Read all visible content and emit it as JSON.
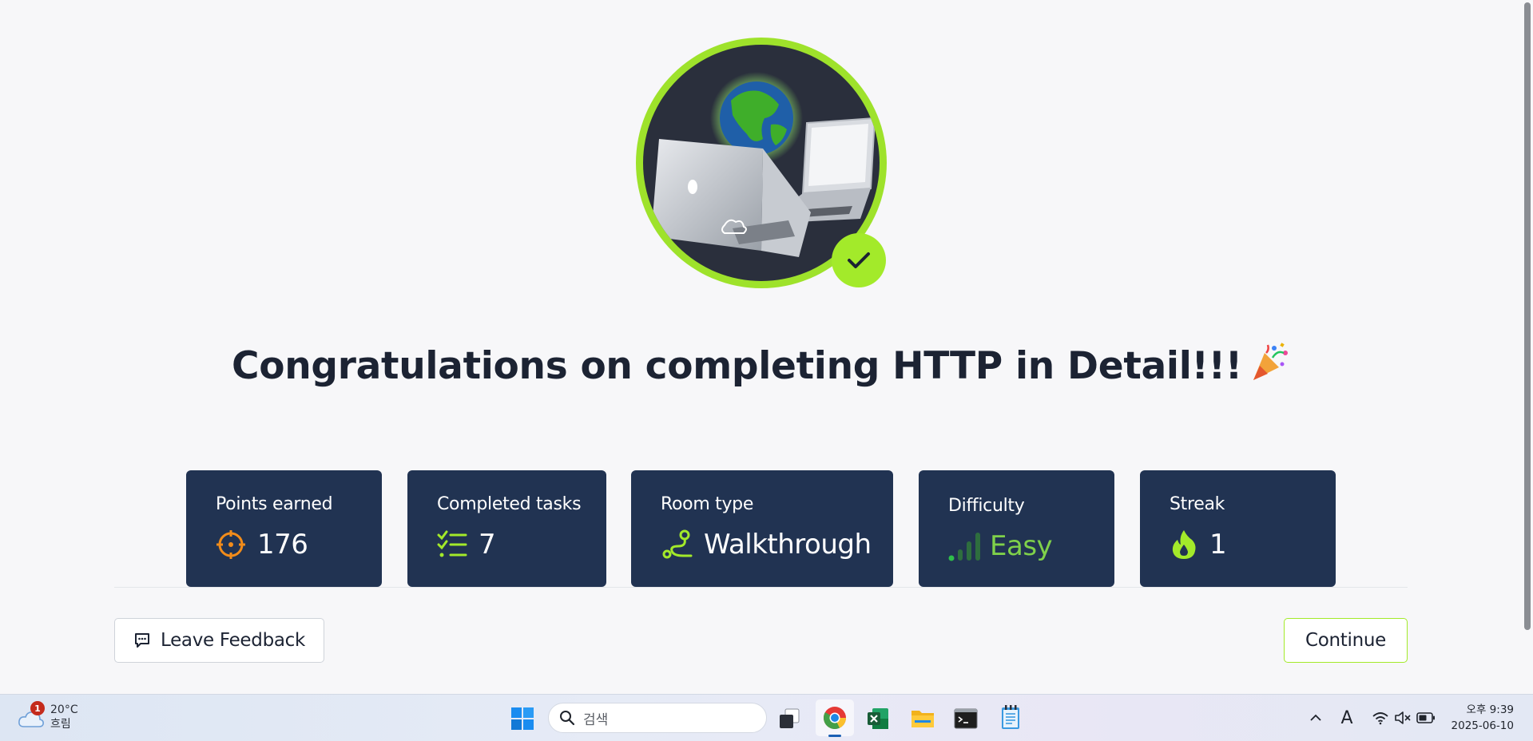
{
  "page": {
    "title_text": "Congratulations on completing HTTP in Detail!!!",
    "title_emoji": "🎉"
  },
  "stats": [
    {
      "label": "Points earned",
      "value": "176",
      "icon": "target-icon"
    },
    {
      "label": "Completed tasks",
      "value": "7",
      "icon": "checklist-icon"
    },
    {
      "label": "Room type",
      "value": "Walkthrough",
      "icon": "route-icon"
    },
    {
      "label": "Difficulty",
      "value": "Easy",
      "icon": "signal-bars-icon"
    },
    {
      "label": "Streak",
      "value": "1",
      "icon": "flame-icon"
    }
  ],
  "actions": {
    "feedback_label": "Leave Feedback",
    "continue_label": "Continue"
  },
  "colors": {
    "accent_green": "#a3ea2a",
    "card_bg": "#213352",
    "orange": "#f28c1a",
    "easy_green": "#7fd14a"
  },
  "taskbar": {
    "weather_temp": "20°C",
    "weather_desc": "흐림",
    "weather_badge": "1",
    "search_placeholder": "검색",
    "time": "오후 9:39",
    "date": "2025-06-10",
    "ime_label": "A"
  }
}
